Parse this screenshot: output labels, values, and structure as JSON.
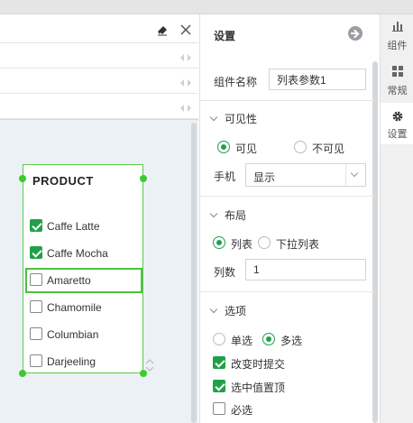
{
  "colors": {
    "accent_green": "#21a04a",
    "selection_green": "#4cc23f",
    "canvas_bg": "#ebf1f5"
  },
  "editor": {
    "icons": [
      "eraser-icon",
      "close-icon"
    ]
  },
  "widget": {
    "title": "PRODUCT",
    "items": [
      {
        "label": "Caffe Latte",
        "checked": true
      },
      {
        "label": "Caffe Mocha",
        "checked": true
      },
      {
        "label": "Amaretto",
        "checked": false,
        "selected": true
      },
      {
        "label": "Chamomile",
        "checked": false
      },
      {
        "label": "Columbian",
        "checked": false
      },
      {
        "label": "Darjeeling",
        "checked": false
      }
    ]
  },
  "panel": {
    "title": "设置",
    "component_name": {
      "label": "组件名称",
      "value": "列表参数1"
    },
    "visibility": {
      "header": "可见性",
      "visible_label": "可见",
      "invisible_label": "不可见",
      "selected": "visible",
      "phone_label": "手机",
      "phone_value": "显示"
    },
    "layout": {
      "header": "布局",
      "list_label": "列表",
      "dropdown_label": "下拉列表",
      "selected": "list",
      "columns_label": "列数",
      "columns_value": "1"
    },
    "options": {
      "header": "选项",
      "single_label": "单选",
      "multi_label": "多选",
      "selected": "multi",
      "submit_on_change": {
        "label": "改变时提交",
        "checked": true
      },
      "pin_selected": {
        "label": "选中值置顶",
        "checked": true
      },
      "required": {
        "label": "必选",
        "checked": false
      }
    }
  },
  "rail": {
    "items": [
      {
        "label": "组件",
        "icon": "bar-chart-icon",
        "active": false
      },
      {
        "label": "常规",
        "icon": "grid-icon",
        "active": false
      },
      {
        "label": "设置",
        "icon": "gear-icon",
        "active": true
      }
    ]
  }
}
